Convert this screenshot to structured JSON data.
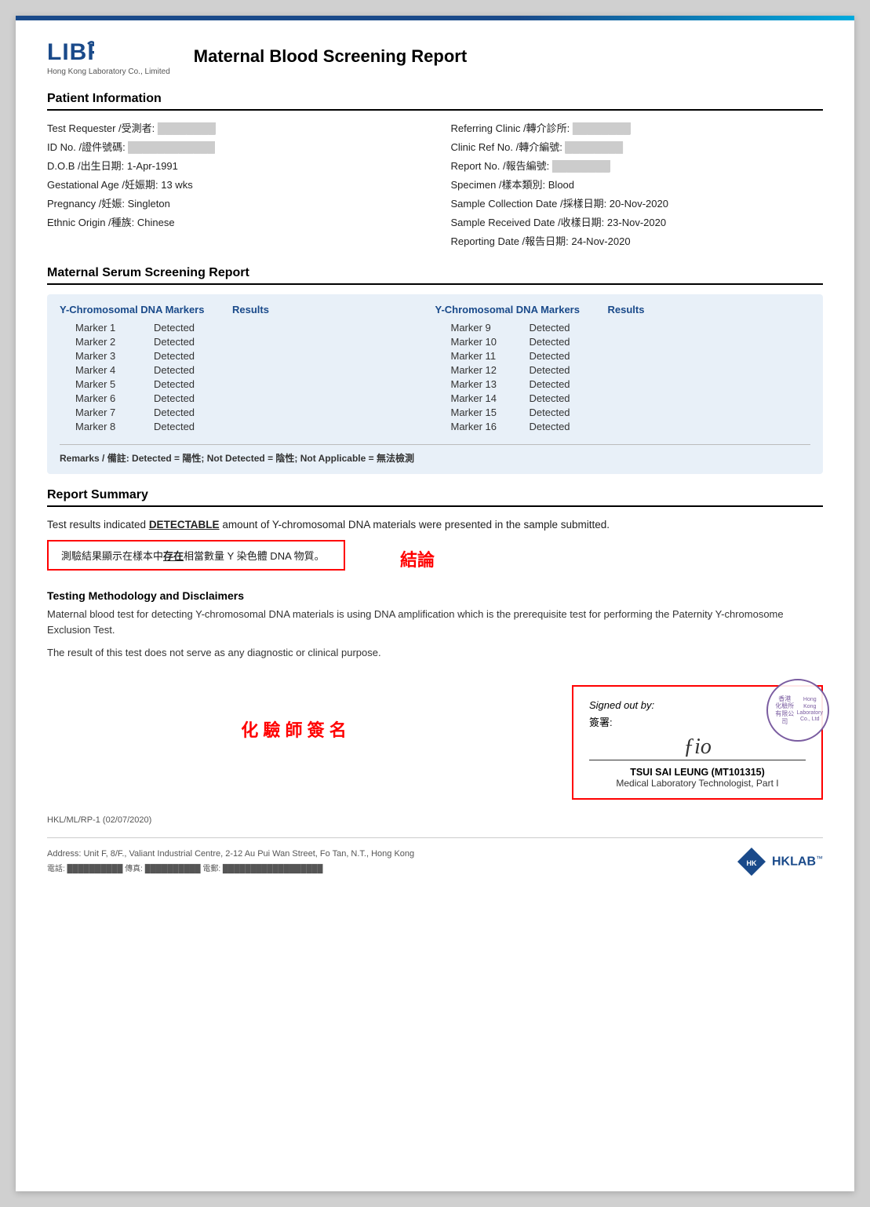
{
  "page": {
    "top_bar_color": "#1a4a8a",
    "logo": {
      "name": "LIBRA",
      "subtitle": "Hong Kong Laboratory Co., Limited"
    },
    "report_title": "Maternal Blood Screening Report"
  },
  "patient_info": {
    "section_title": "Patient Information",
    "left": [
      {
        "label": "Test Requester /受測者:",
        "value": "███████"
      },
      {
        "label": "ID No. /證件號碼:",
        "value": "███████████"
      },
      {
        "label": "D.O.B /出生日期:",
        "value": "1-Apr-1991"
      },
      {
        "label": "Gestational Age /妊娠期:",
        "value": "13 wks"
      },
      {
        "label": "Pregnancy /妊娠:",
        "value": "Singleton"
      },
      {
        "label": "Ethnic Origin /種族:",
        "value": "Chinese"
      }
    ],
    "right": [
      {
        "label": "Referring Clinic /轉介診所:",
        "value": "███████"
      },
      {
        "label": "Clinic Ref No. /轉介編號:",
        "value": "███████"
      },
      {
        "label": "Report No. /報告編號:",
        "value": "███████"
      },
      {
        "label": "Specimen /樣本類別:",
        "value": "Blood"
      },
      {
        "label": "Sample Collection Date /採樣日期:",
        "value": "20-Nov-2020"
      },
      {
        "label": "Sample Received Date /收樣日期:",
        "value": "23-Nov-2020"
      },
      {
        "label": "Reporting Date /報告日期:",
        "value": "24-Nov-2020"
      }
    ]
  },
  "screening_report": {
    "section_title": "Maternal Serum Screening Report",
    "col_headers": {
      "marker": "Y-Chromosomal DNA Markers",
      "results": "Results"
    },
    "left_markers": [
      {
        "name": "Marker 1",
        "result": "Detected"
      },
      {
        "name": "Marker 2",
        "result": "Detected"
      },
      {
        "name": "Marker 3",
        "result": "Detected"
      },
      {
        "name": "Marker 4",
        "result": "Detected"
      },
      {
        "name": "Marker 5",
        "result": "Detected"
      },
      {
        "name": "Marker 6",
        "result": "Detected"
      },
      {
        "name": "Marker 7",
        "result": "Detected"
      },
      {
        "name": "Marker 8",
        "result": "Detected"
      }
    ],
    "right_markers": [
      {
        "name": "Marker 9",
        "result": "Detected"
      },
      {
        "name": "Marker 10",
        "result": "Detected"
      },
      {
        "name": "Marker 11",
        "result": "Detected"
      },
      {
        "name": "Marker 12",
        "result": "Detected"
      },
      {
        "name": "Marker 13",
        "result": "Detected"
      },
      {
        "name": "Marker 14",
        "result": "Detected"
      },
      {
        "name": "Marker 15",
        "result": "Detected"
      },
      {
        "name": "Marker 16",
        "result": "Detected"
      }
    ],
    "remarks": "Remarks / 備註: Detected = 陽性; Not Detected = 陰性; Not Applicable = 無法檢測"
  },
  "report_summary": {
    "section_title": "Report Summary",
    "summary_line1": "Test results indicated ",
    "detectable_word": "DETECTABLE",
    "summary_line2": " amount of Y-chromosomal DNA materials were presented in the sample submitted.",
    "chinese_line1": "測驗結果顯示在樣本中",
    "chinese_underline": "存在",
    "chinese_line2": "相當數量 Y 染色體 DNA 物質。",
    "conclusion_label": "結論"
  },
  "methodology": {
    "title": "Testing Methodology and Disclaimers",
    "text1": "Maternal blood test for detecting Y-chromosomal DNA materials is using DNA amplification which is the prerequisite test for performing the Paternity Y-chromosome Exclusion Test.",
    "text2": "The result of this test does not serve as any diagnostic or clinical purpose."
  },
  "signature_section": {
    "chemist_label": "化 驗 師 簽 名",
    "signed_out_by": "Signed out by:",
    "signed_out_chinese": "簽署:",
    "signature_text": "ƒio",
    "signatory_name": "TSUI SAI LEUNG (MT101315)",
    "signatory_title": "Medical Laboratory Technologist, Part I",
    "stamp_text": "香港\n化驗所\n有限公司\nHong Kong\nLaboratory\nCo., Limited"
  },
  "form_no": "HKL/ML/RP-1 (02/07/2020)",
  "footer": {
    "address": "Address: Unit F, 8/F., Valiant Industrial Centre, 2-12 Au Pui Wan Street, Fo Tan, N.T., Hong Kong",
    "contact": "電話: ██████████    傳真: ██████████    電郵: ██████████████████",
    "hklab_logo_text": "HKLAB"
  }
}
